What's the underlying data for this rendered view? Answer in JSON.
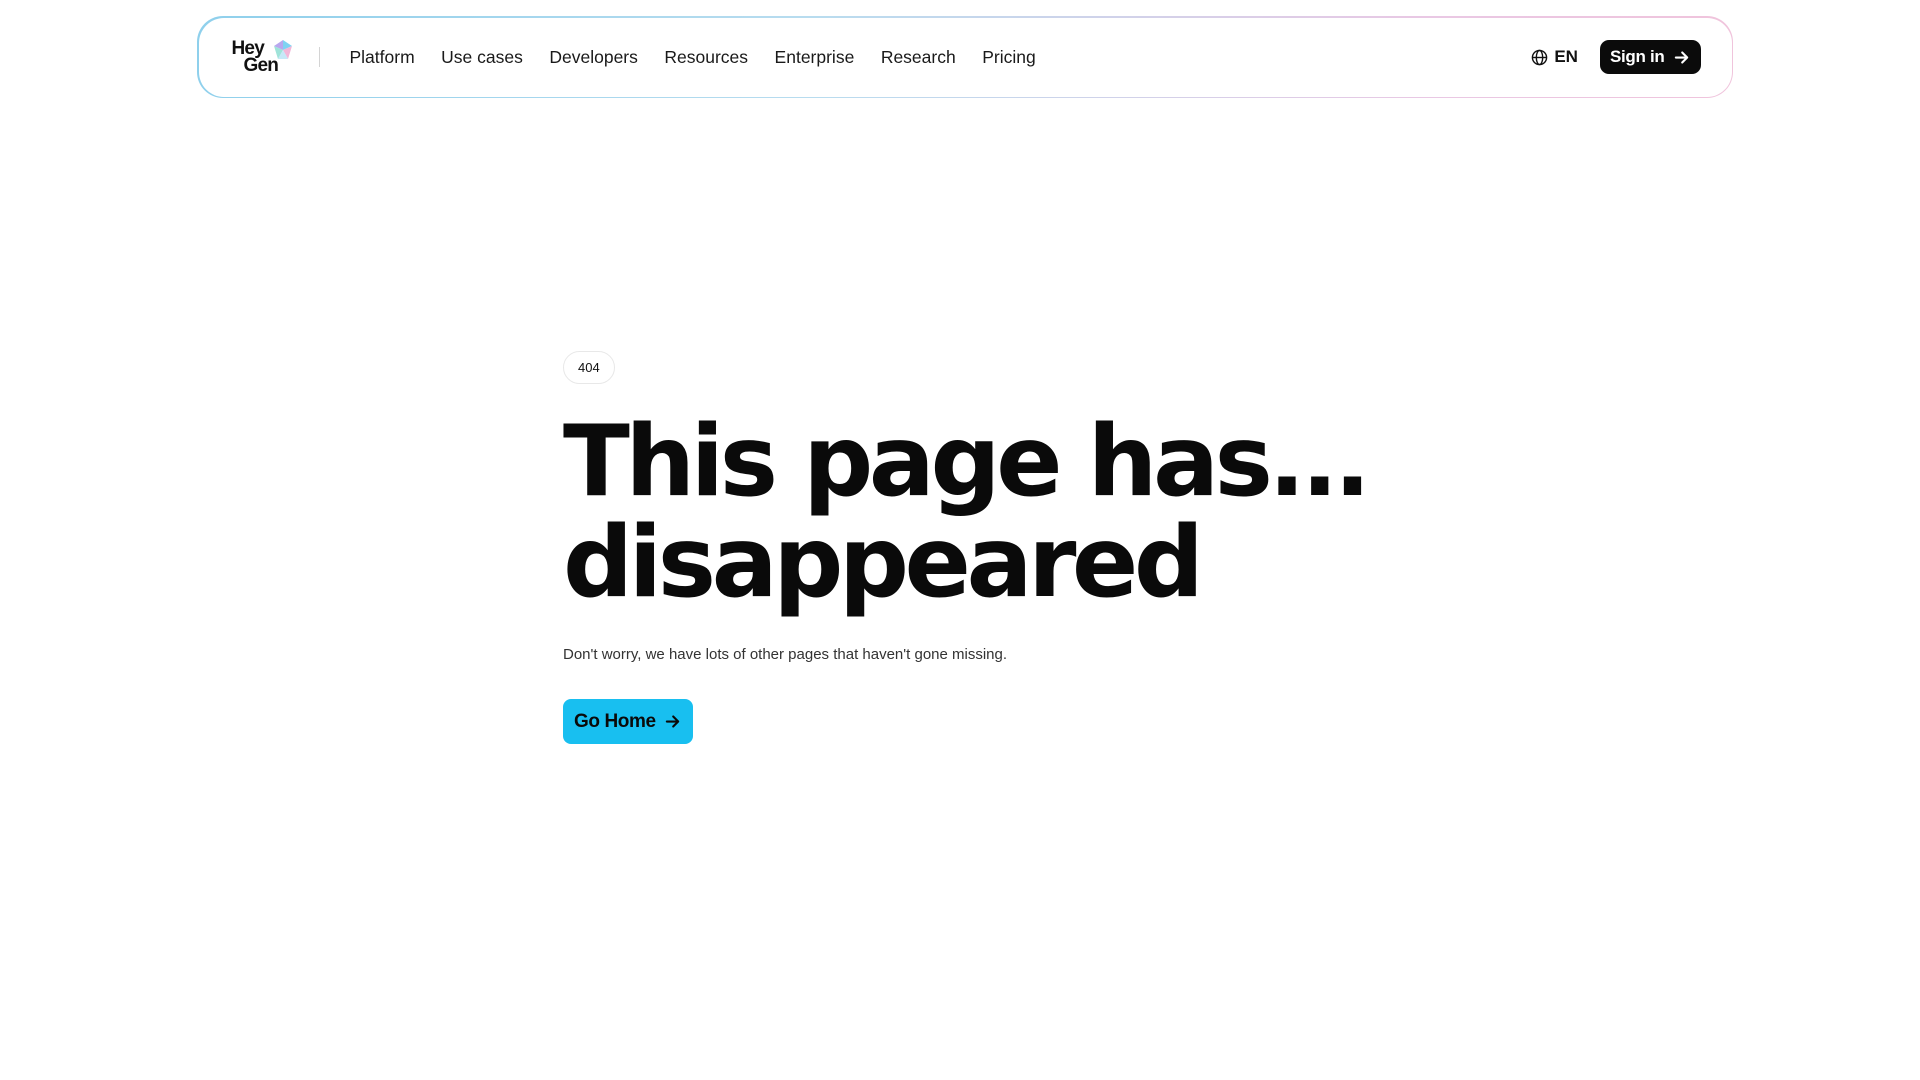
{
  "nav": {
    "logo": {
      "line1": "Hey",
      "line2": "Gen"
    },
    "items": [
      {
        "label": "Platform"
      },
      {
        "label": "Use cases"
      },
      {
        "label": "Developers"
      },
      {
        "label": "Resources"
      },
      {
        "label": "Enterprise"
      },
      {
        "label": "Research"
      },
      {
        "label": "Pricing"
      }
    ],
    "language": {
      "label": "EN",
      "icon": "globe-icon"
    },
    "signin": {
      "label": "Sign in",
      "icon": "arrow-right-icon"
    }
  },
  "main": {
    "badge": "404",
    "headline": {
      "line1": "This page has...",
      "line2": "disappeared"
    },
    "subtext": "Don't worry, we have lots of other pages that haven't gone missing.",
    "cta": {
      "label": "Go Home",
      "icon": "arrow-right-icon"
    }
  },
  "colors": {
    "accent": "#18bff0",
    "button_dark": "#0b0b0b",
    "text": "#0a0a0a"
  }
}
